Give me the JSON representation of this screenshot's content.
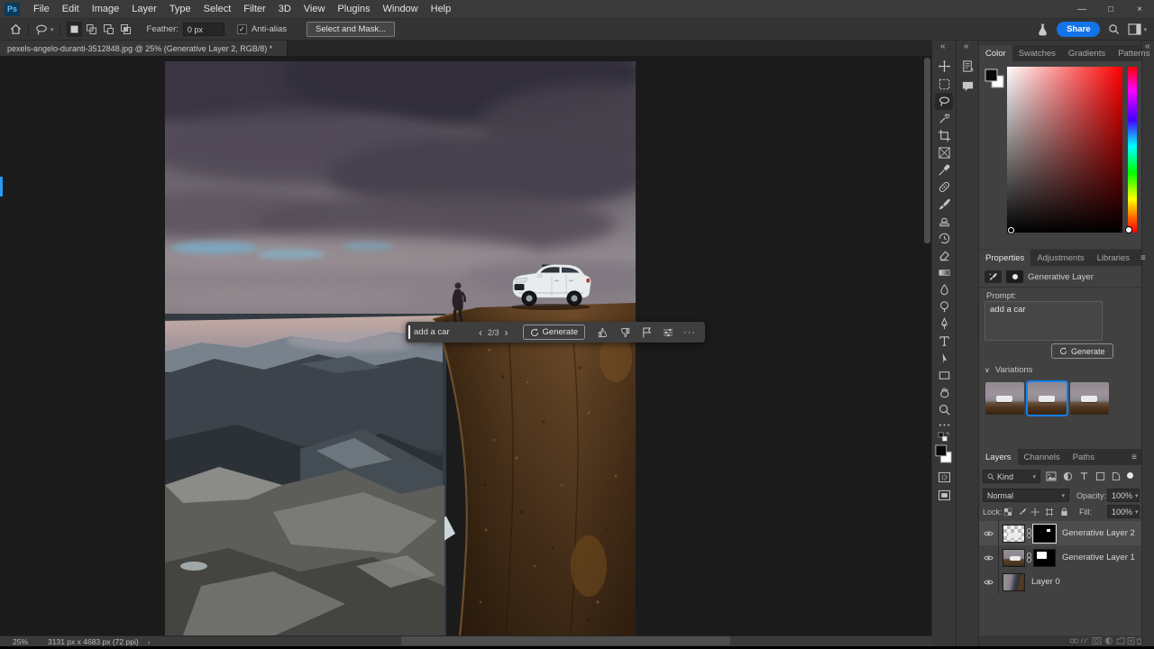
{
  "window": {
    "logo": "Ps",
    "controls": {
      "minimize": "—",
      "maximize": "□",
      "close": "×"
    }
  },
  "menu": {
    "items": [
      "File",
      "Edit",
      "Image",
      "Layer",
      "Type",
      "Select",
      "Filter",
      "3D",
      "View",
      "Plugins",
      "Window",
      "Help"
    ]
  },
  "options_bar": {
    "feather_label": "Feather:",
    "feather_value": "0 px",
    "anti_alias_label": "Anti-alias",
    "select_and_mask": "Select and Mask...",
    "share": "Share"
  },
  "document_tab": {
    "title": "pexels-angelo-duranti-3512848.jpg @ 25% (Generative Layer 2, RGB/8) *"
  },
  "taskbar": {
    "prompt": "add a car",
    "pager": "2/3",
    "generate": "Generate"
  },
  "color_panel": {
    "tabs": [
      "Color",
      "Swatches",
      "Gradients",
      "Patterns"
    ]
  },
  "properties_panel": {
    "tabs": [
      "Properties",
      "Adjustments",
      "Libraries"
    ],
    "layer_type": "Generative Layer",
    "prompt_label": "Prompt:",
    "prompt_value": "add a car",
    "generate": "Generate",
    "variations_label": "Variations"
  },
  "layers_panel": {
    "tabs": [
      "Layers",
      "Channels",
      "Paths"
    ],
    "kind": "Kind",
    "blend_mode": "Normal",
    "opacity_label": "Opacity:",
    "opacity_value": "100%",
    "lock_label": "Lock:",
    "fill_label": "Fill:",
    "fill_value": "100%",
    "layers": [
      {
        "name": "Generative Layer 2"
      },
      {
        "name": "Generative Layer 1"
      },
      {
        "name": "Layer 0"
      }
    ]
  },
  "status_bar": {
    "zoom_level": "25%",
    "doc_info": "3131 px x 4683 px (72 ppi)"
  },
  "glyphs": {
    "chevron_down": "▾",
    "chevron_left": "‹",
    "chevron_right": "›",
    "collapse": "«",
    "more": "···",
    "check": "✓",
    "menu": "≡",
    "variations_caret": "∨"
  },
  "colors": {
    "accent": "#1473e6",
    "selected_variation_border": "#1380f0"
  }
}
